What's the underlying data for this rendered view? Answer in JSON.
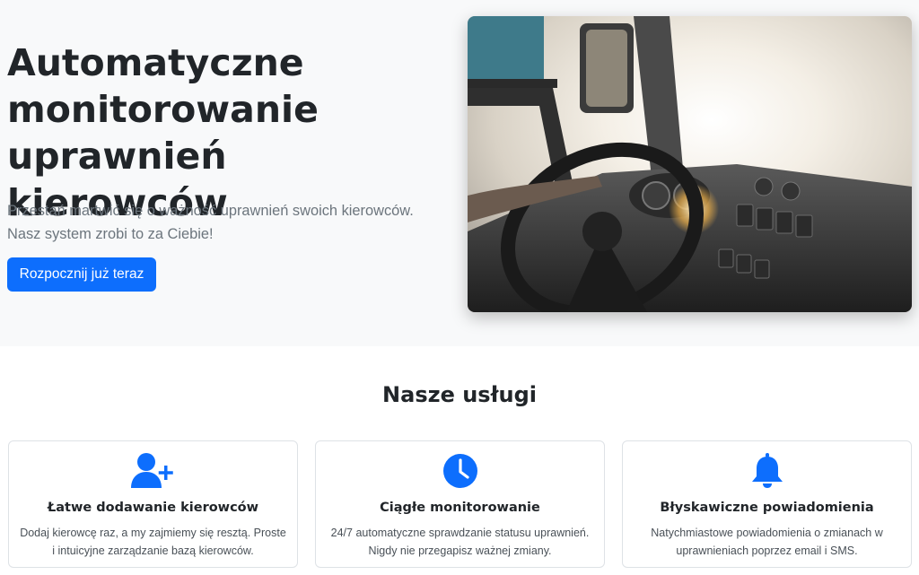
{
  "hero": {
    "title": "Automatyczne monitorowanie uprawnień kierowców",
    "lead": "Przestań martwić się o ważność uprawnień swoich kierowców. Nasz system zrobi to za Ciebie!",
    "cta_label": "Rozpocznij już teraz"
  },
  "services": {
    "title": "Nasze usługi",
    "items": [
      {
        "icon": "user-plus-icon",
        "title": "Łatwe dodawanie kierowców",
        "text": "Dodaj kierowcę raz, a my zajmiemy się resztą. Proste i intuicyjne zarządzanie bazą kierowców."
      },
      {
        "icon": "clock-icon",
        "title": "Ciągłe monitorowanie",
        "text": "24/7 automatyczne sprawdzanie statusu uprawnień. Nigdy nie przegapisz ważnej zmiany."
      },
      {
        "icon": "bell-icon",
        "title": "Błyskawiczne powiadomienia",
        "text": "Natychmiastowe powiadomienia o zmianach w uprawnieniach poprzez email i SMS."
      }
    ]
  },
  "colors": {
    "primary": "#0d6efd",
    "hero_bg": "#f8f9fa",
    "muted_text": "#6c757d"
  }
}
